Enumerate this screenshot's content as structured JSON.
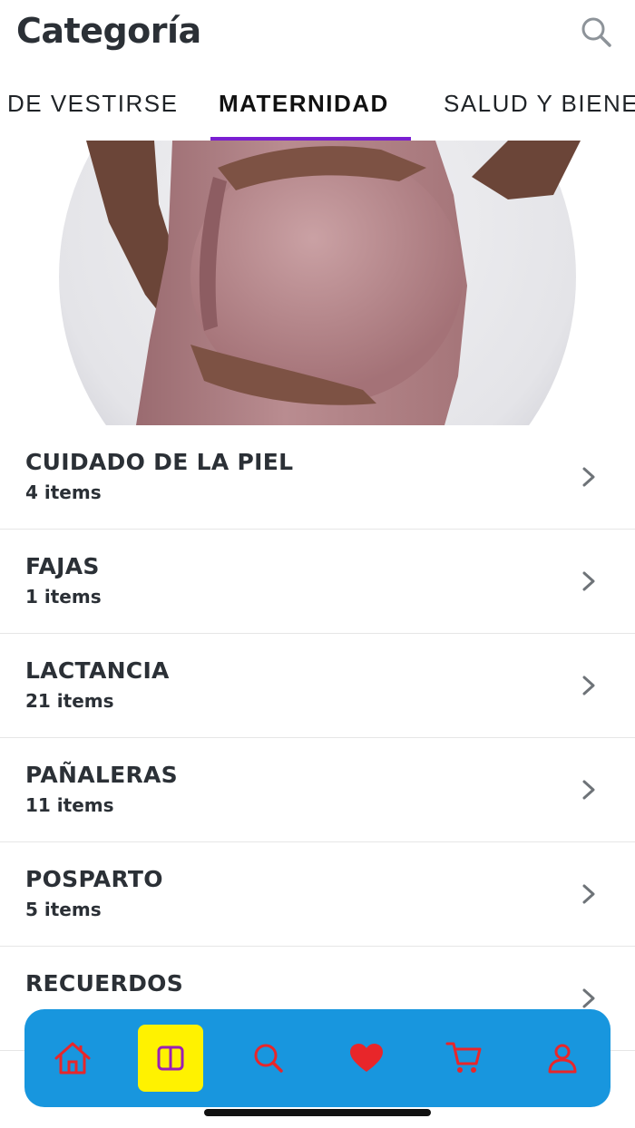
{
  "header": {
    "title": "Categoría",
    "search_icon": "search-icon"
  },
  "tabs": [
    {
      "label": "DE VESTIRSE",
      "active": false
    },
    {
      "label": "MATERNIDAD",
      "active": true
    },
    {
      "label": "SALUD Y BIENE",
      "active": false
    }
  ],
  "colors": {
    "accent": "#7a1fd1",
    "nav_bg": "#1896de",
    "nav_icon": "#e8262a",
    "nav_active_bg": "#fff200"
  },
  "categories": [
    {
      "name": "CUIDADO DE LA PIEL",
      "count": "4 items"
    },
    {
      "name": "FAJAS",
      "count": "1 items"
    },
    {
      "name": "LACTANCIA",
      "count": "21 items"
    },
    {
      "name": "PAÑALERAS",
      "count": "11 items"
    },
    {
      "name": "POSPARTO",
      "count": "5 items"
    },
    {
      "name": "RECUERDOS",
      "count": ""
    }
  ],
  "bottom_nav": [
    {
      "icon": "home-icon",
      "active": false
    },
    {
      "icon": "categories-icon",
      "active": true
    },
    {
      "icon": "search-icon",
      "active": false
    },
    {
      "icon": "heart-icon",
      "active": false
    },
    {
      "icon": "cart-icon",
      "active": false
    },
    {
      "icon": "user-icon",
      "active": false
    }
  ]
}
